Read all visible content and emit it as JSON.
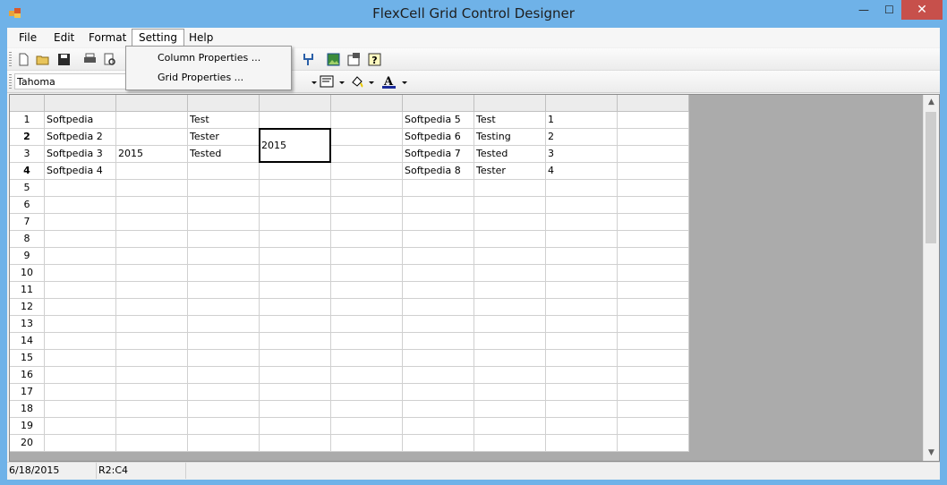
{
  "window": {
    "title": "FlexCell Grid Control Designer",
    "minimize": "—",
    "maximize": "☐",
    "close": "✕"
  },
  "menu": [
    {
      "label": "File"
    },
    {
      "label": "Edit"
    },
    {
      "label": "Format"
    },
    {
      "label": "Setting"
    },
    {
      "label": "Help"
    }
  ],
  "setting_menu": {
    "items": [
      "Column Properties ...",
      "Grid Properties ..."
    ]
  },
  "toolbar": {
    "icons": [
      "new-icon",
      "open-icon",
      "save-icon",
      "print-icon",
      "print-preview-icon",
      "merge-icon",
      "image-icon",
      "properties-icon",
      "help-icon"
    ],
    "font_name": "Tahoma"
  },
  "grid": {
    "row_labels": [
      "1",
      "2",
      "3",
      "4",
      "5",
      "6",
      "7",
      "8",
      "9",
      "10",
      "11",
      "12",
      "13",
      "14",
      "15",
      "16",
      "17",
      "18",
      "19",
      "20"
    ],
    "cells": [
      [
        "Softpedia",
        "",
        "Test",
        "",
        "",
        "Softpedia 5",
        "Test",
        "1",
        ""
      ],
      [
        "Softpedia 2",
        "",
        "Tester",
        "",
        "",
        "Softpedia 6",
        "Testing",
        "2",
        ""
      ],
      [
        "Softpedia 3",
        "2015",
        "Tested",
        "2015",
        "",
        "Softpedia 7",
        "Tested",
        "3",
        ""
      ],
      [
        "Softpedia 4",
        "",
        "",
        "",
        "",
        "Softpedia 8",
        "Tester",
        "4",
        ""
      ]
    ],
    "selected_value": "2015"
  },
  "status": {
    "date": "6/18/2015",
    "cell_ref": "R2:C4"
  },
  "colors": {
    "title_bar": "#6fb2e8",
    "close_button": "#c7504b",
    "grid_background": "#ababab"
  }
}
